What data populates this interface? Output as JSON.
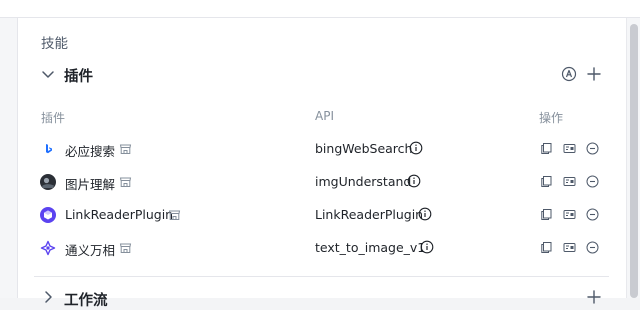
{
  "section": {
    "title": "技能"
  },
  "plugins": {
    "header_label": "插件",
    "columns": {
      "name": "插件",
      "api": "API",
      "actions": "操作"
    },
    "rows": [
      {
        "name": "必应搜索",
        "api": "bingWebSearch",
        "icon": "bing-icon"
      },
      {
        "name": "图片理解",
        "api": "imgUnderstand",
        "icon": "image-understand-avatar"
      },
      {
        "name": "LinkReaderPlugin",
        "api": "LinkReaderPlugin",
        "icon": "link-reader-icon"
      },
      {
        "name": "通义万相",
        "api": "text_to_image_v1",
        "icon": "tongyi-wanxiang-icon"
      }
    ]
  },
  "next_section": {
    "label": "工作流"
  },
  "colors": {
    "accent": "#1e6fff",
    "text": "#1f2329",
    "muted": "#86909c",
    "icon": "#4e5969"
  }
}
